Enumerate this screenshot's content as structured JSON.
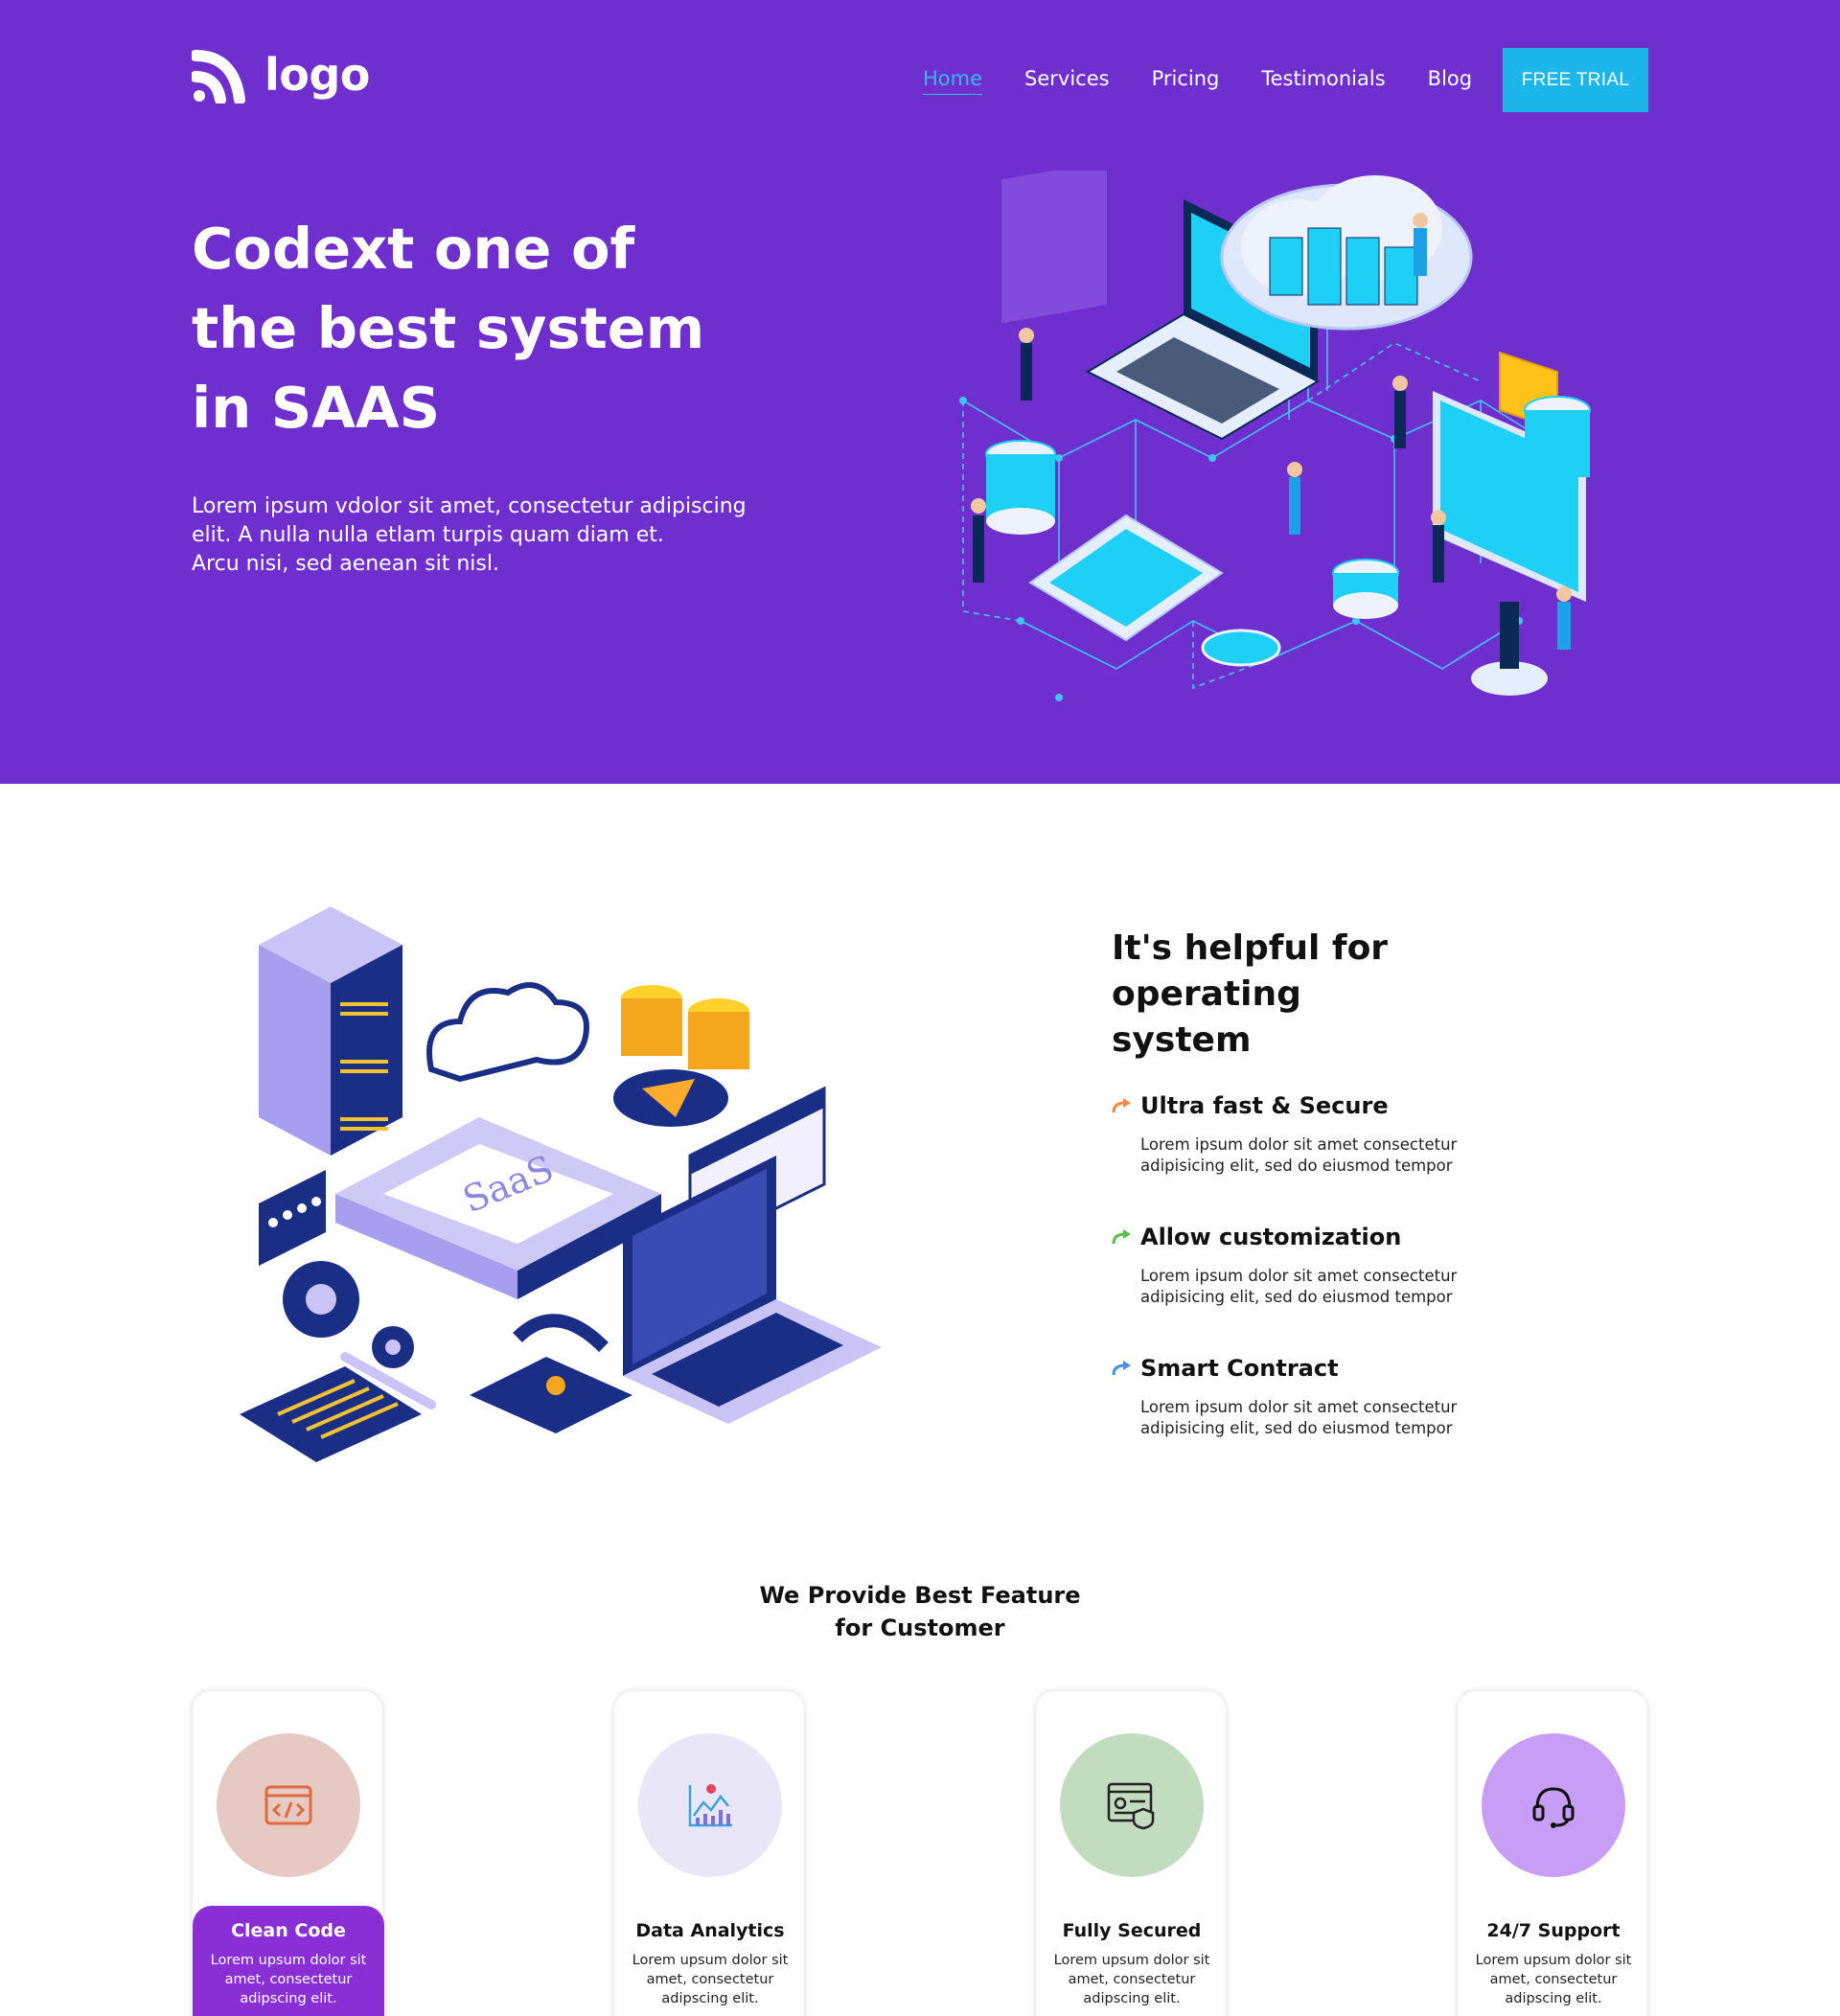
{
  "brand": {
    "logo_text": "logo"
  },
  "nav": {
    "items": [
      "Home",
      "Services",
      "Pricing",
      "Testimonials",
      "Blog"
    ],
    "cta": "FREE TRIAL"
  },
  "hero": {
    "title_lines": [
      "Codext one of",
      "the best system",
      "in SAAS"
    ],
    "desc_lines": [
      "Lorem ipsum vdolor sit amet, consectetur adipiscing",
      "elit. A nulla nulla etlam turpis quam diam et.",
      "Arcu nisi, sed aenean sit nisl."
    ]
  },
  "about": {
    "title_lines": [
      "It's helpful for operating",
      "system"
    ],
    "features": [
      {
        "title": "Ultra fast & Secure",
        "desc_lines": [
          "Lorem ipsum dolor sit amet consectetur",
          "adipisicing elit, sed do eiusmod tempor"
        ],
        "arrow_color": "#f4894a"
      },
      {
        "title": "Allow customization",
        "desc_lines": [
          "Lorem ipsum dolor sit amet consectetur",
          "adipisicing elit, sed do eiusmod tempor"
        ],
        "arrow_color": "#5bbf4c"
      },
      {
        "title": "Smart Contract",
        "desc_lines": [
          "Lorem ipsum dolor sit amet consectetur",
          "adipisicing elit, sed do eiusmod tempor"
        ],
        "arrow_color": "#4a8fe8"
      }
    ],
    "illustration_label": "SaaS"
  },
  "services": {
    "title_lines": [
      "We Provide Best Feature",
      "for Customer"
    ],
    "cards": [
      {
        "title": "Clean Code",
        "desc_lines": [
          "Lorem upsum dolor sit",
          "amet, consectetur",
          "adipscing elit."
        ],
        "circle_color": "#e6c9c3",
        "icon": "code-window-icon",
        "active": true
      },
      {
        "title": "Data Analytics",
        "desc_lines": [
          "Lorem upsum dolor sit",
          "amet, consectetur",
          "adipscing elit."
        ],
        "circle_color": "#e9e6f8",
        "icon": "analytics-chart-icon",
        "active": false
      },
      {
        "title": "Fully Secured",
        "desc_lines": [
          "Lorem upsum dolor sit",
          "amet, consectetur",
          "adipscing elit."
        ],
        "circle_color": "#c2dcc0",
        "icon": "secure-document-icon",
        "active": false
      },
      {
        "title": "24/7 Support",
        "desc_lines": [
          "Lorem upsum dolor sit",
          "amet, consectetur",
          "adipscing elit."
        ],
        "circle_color": "#c89df5",
        "icon": "headset-icon",
        "active": false
      }
    ]
  },
  "colors": {
    "hero_bg": "#6f2fcf",
    "accent": "#1db6ea",
    "active_card": "#8a2fd6"
  }
}
